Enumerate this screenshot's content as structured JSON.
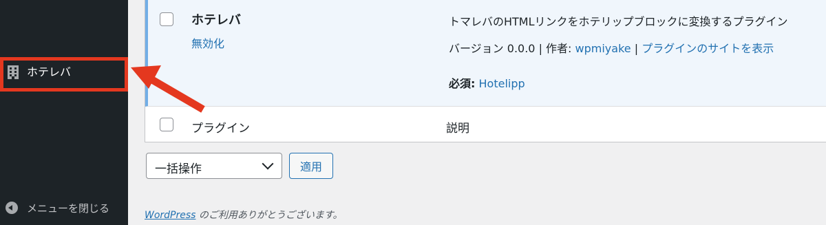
{
  "sidebar": {
    "menu_item_label": "ホテレバ",
    "collapse_label": "メニューを閉じる"
  },
  "plugin_row": {
    "name": "ホテレバ",
    "action_deactivate": "無効化",
    "description": "トマレバのHTMLリンクをホテリップブロックに変換するプラグイン",
    "version_label": "バージョン 0.0.0 | 作者: ",
    "author": "wpmiyake",
    "separator": " | ",
    "site_link": "プラグインのサイトを表示",
    "required_label": "必須:",
    "required_plugin": "Hotelipp"
  },
  "table_footer": {
    "col_plugin": "プラグイン",
    "col_description": "説明"
  },
  "bulk_actions": {
    "selected": "一括操作",
    "apply": "適用"
  },
  "footer": {
    "wordpress_link": "WordPress",
    "thanks_text": " のご利用ありがとうございます。"
  },
  "colors": {
    "sidebar_bg": "#1d2327",
    "highlight": "#e4381f",
    "link": "#2271b1",
    "active_row_bg": "#f0f6fc",
    "active_border": "#72aee6"
  }
}
